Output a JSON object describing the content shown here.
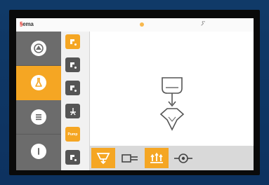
{
  "brand": {
    "mark": "§",
    "name": "ema"
  },
  "icons": {
    "status": "warning-dot-icon",
    "service": "wrench-icon"
  },
  "sidebar": {
    "items": [
      {
        "icon": "dashboard-icon",
        "active": false
      },
      {
        "icon": "flask-icon",
        "active": true
      },
      {
        "icon": "list-icon",
        "active": false
      },
      {
        "icon": "info-icon",
        "active": false
      }
    ]
  },
  "subnav": {
    "items": [
      {
        "icon": "spray-gun-icon",
        "active": true
      },
      {
        "icon": "spray-gun-icon",
        "active": false
      },
      {
        "icon": "spray-gun-icon",
        "active": false
      },
      {
        "icon": "person-icon",
        "active": false
      },
      {
        "label": "Pump",
        "active": true
      },
      {
        "icon": "spray-gun-icon",
        "active": false
      }
    ]
  },
  "bottom": {
    "items": [
      {
        "icon": "hopper-icon",
        "active": true
      },
      {
        "icon": "pump-icon",
        "active": false
      },
      {
        "icon": "fluidize-icon",
        "active": true
      },
      {
        "icon": "valve-icon",
        "active": false
      }
    ]
  },
  "colors": {
    "accent": "#f5a623",
    "sidebar": "#6c6c6c"
  }
}
